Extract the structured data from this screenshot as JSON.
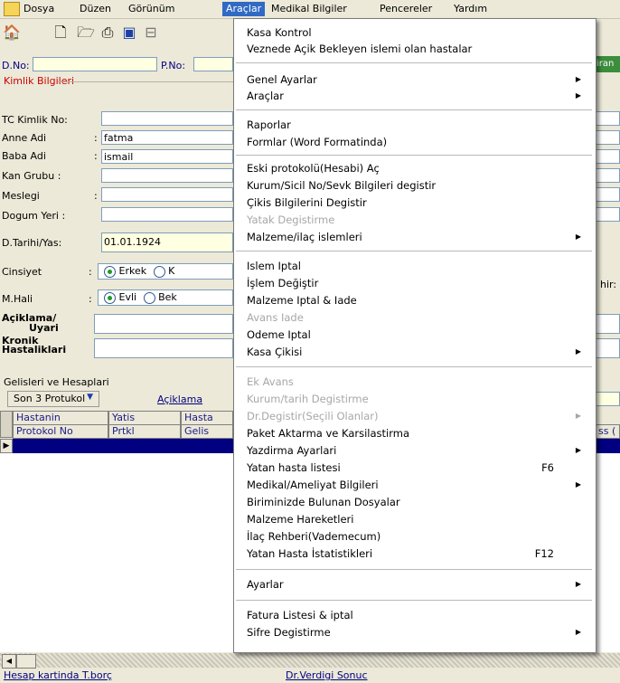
{
  "menubar": {
    "items": [
      "Dosya",
      "Düzen",
      "Görünüm",
      "Araçlar",
      "Medikal Bilgiler",
      "Pencereler",
      "Yardım"
    ]
  },
  "form": {
    "d_no_label": "D.No:",
    "p_no_label": "P.No:",
    "right_cut_label": "iran",
    "kimlik_group": "Kimlik Bilgileri",
    "tc_label": "TC Kimlik No:",
    "anne_label": "Anne Adi",
    "anne_value": "fatma",
    "baba_label": "Baba Adi",
    "baba_value": "ismail",
    "kan_label": "Kan Grubu :",
    "meslegi_label": "Meslegi",
    "dogum_label": "Dogum Yeri :",
    "tarih_label": "D.Tarihi/Yas:",
    "tarih_value": "01.01.1924",
    "cinsiyet_label": "Cinsiyet",
    "cins_opt1": "Erkek",
    "cins_opt2": "K",
    "mhali_label": "M.Hali",
    "mhali_opt1": "Evli",
    "mhali_opt2": "Bek",
    "aciklama_label1": "Açiklama/",
    "aciklama_label2": "Uyari",
    "kronik_label1": "Kronik",
    "kronik_label2": "Hastaliklari",
    "right_hir": "hir:",
    "gelis_group": "Gelisleri ve Hesaplari",
    "dropdown_value": "Son 3 Protukol",
    "aciklama_link": "Açiklama",
    "grid_headers_row1": [
      "Hastanin",
      "Yatis",
      "Hasta"
    ],
    "grid_headers_row2": [
      "Protokol No",
      "Prtkl",
      "Gelis"
    ],
    "grid_right_fragment": "ss (",
    "col1_colon": ":"
  },
  "status": {
    "left": "Hesap kartinda T.borç",
    "mid": "Dr.Verdigi Sonuc"
  },
  "menu": {
    "kasa_kontrol": "Kasa Kontrol",
    "veznede": "Veznede Açik Bekleyen islemi olan hastalar",
    "genel_ayarlar": "Genel Ayarlar",
    "araclar": "Araçlar",
    "raporlar": "Raporlar",
    "formlar": "Formlar (Word Formatinda)",
    "eski_protokol": "Eski protokolü(Hesabi) Aç",
    "kurum_sicil": "Kurum/Sicil No/Sevk Bilgileri degistir",
    "cikis": "Çikis Bilgilerini Degistir",
    "yatak": "Yatak Degistirme",
    "malzeme_ilac": "Malzeme/ilaç islemleri",
    "islem_iptal": "Islem Iptal",
    "islem_degistir": "İşlem Değiştir",
    "malzeme_iptal": "Malzeme Iptal & Iade",
    "avans_iade": "Avans Iade",
    "odeme_iptal": "Odeme Iptal",
    "kasa_cikisi": "Kasa Çikisi",
    "ek_avans": "Ek Avans",
    "kurum_tarih": "Kurum/tarih Degistirme",
    "dr_degistir": "Dr.Degistir(Seçili Olanlar)",
    "paket": "Paket Aktarma ve Karsilastirma",
    "yazdirma": "Yazdirma Ayarlari",
    "yatan_liste": "Yatan hasta listesi",
    "yatan_liste_sc": "F6",
    "medikal": "Medikal/Ameliyat Bilgileri",
    "biriminizde": "Biriminizde Bulunan Dosyalar",
    "malzeme_hareket": "Malzeme Hareketleri",
    "ilac_rehberi": "İlaç Rehberi(Vademecum)",
    "yatan_istat": "Yatan Hasta İstatistikleri",
    "yatan_istat_sc": "F12",
    "ayarlar": "Ayarlar",
    "fatura": "Fatura Listesi & iptal",
    "sifre": "Sifre Degistirme"
  },
  "colors": {
    "menu_highlight": "#316ac5",
    "field_yellow": "#ffffe1",
    "group_red": "#cc0000",
    "grid_selected_row": "#000080"
  }
}
